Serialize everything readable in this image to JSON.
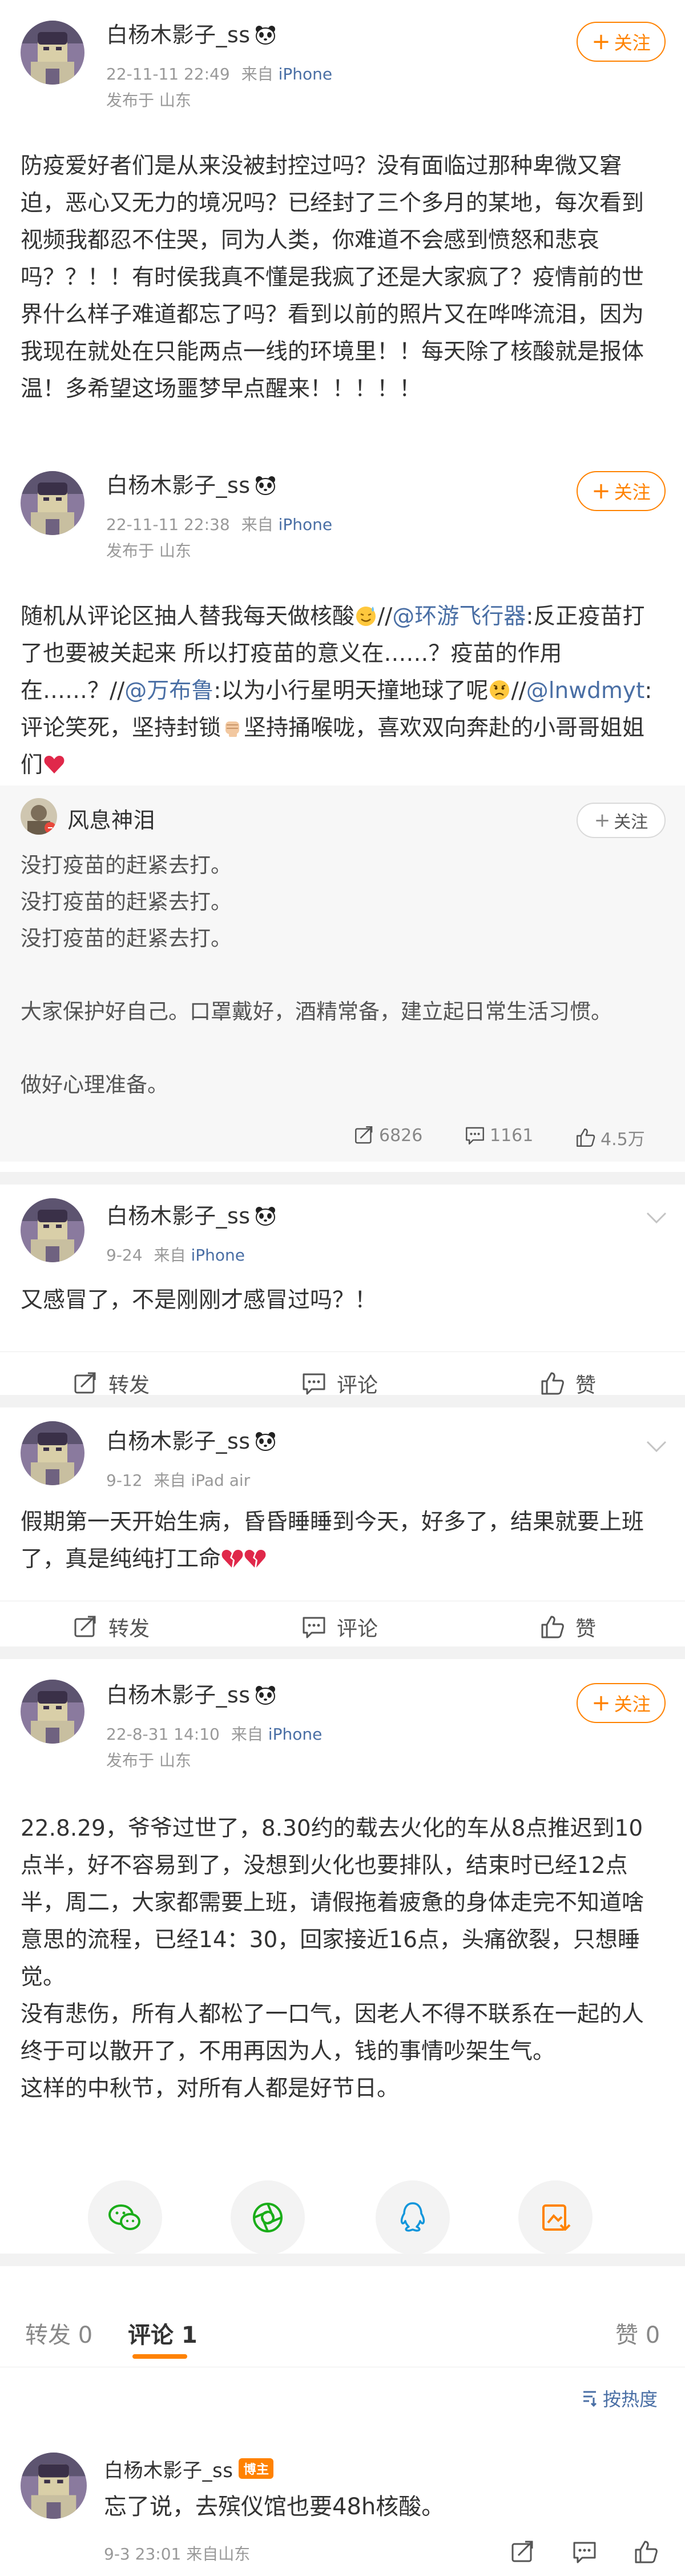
{
  "posts": [
    {
      "user": "白杨木影子_ss",
      "time": "22-11-11 22:49",
      "source_prefix": "来自",
      "device": "iPhone",
      "location": "发布于 山东",
      "follow_label": "关注",
      "text": "防疫爱好者们是从来没被封控过吗？没有面临过那种卑微又窘迫，恶心又无力的境况吗？已经封了三个多月的某地，每次看到视频我都忍不住哭，同为人类，你难道不会感到愤怒和悲哀吗？？！！有时侯我真不懂是我疯了还是大家疯了？疫情前的世界什么样子难道都忘了吗？看到以前的照片又在哗哗流泪，因为我现在就处在只能两点一线的环境里！！每天除了核酸就是报体温！多希望这场噩梦早点醒来！！！！！"
    },
    {
      "user": "白杨木影子_ss",
      "time": "22-11-11 22:38",
      "source_prefix": "来自",
      "device": "iPhone",
      "location": "发布于 山东",
      "follow_label": "关注",
      "text_parts": {
        "p1": "随机从评论区抽人替我每天做核酸",
        "p2": "//",
        "m1": "@环游飞行器",
        "p3": ":反正疫苗打了也要被关起来 所以打疫苗的意义在……？疫苗的作用在……？//",
        "m2": "@万布鲁",
        "p4": ":以为小行星明天撞地球了呢",
        "p5": "//",
        "m3": "@lnwdmyt",
        "p6": ":评论笑死，坚持封锁",
        "p7": "坚持捅喉咙，喜欢双向奔赴的小哥哥姐姐们"
      },
      "repost": {
        "user": "风息神泪",
        "follow_label": "关注",
        "text": "没打疫苗的赶紧去打。\n没打疫苗的赶紧去打。\n没打疫苗的赶紧去打。\n\n大家保护好自己。口罩戴好，酒精常备，建立起日常生活习惯。\n\n做好心理准备。",
        "reposts": "6826",
        "comments": "1161",
        "likes": "4.5万"
      }
    },
    {
      "user": "白杨木影子_ss",
      "time": "9-24",
      "source_prefix": "来自",
      "device": "iPhone",
      "text": "又感冒了，不是刚刚才感冒过吗？！"
    },
    {
      "user": "白杨木影子_ss",
      "time": "9-12",
      "source_prefix": "来自",
      "device": "iPad air",
      "text": "假期第一天开始生病，昏昏睡睡到今天，好多了，结果就要上班了，真是纯纯打工命"
    },
    {
      "user": "白杨木影子_ss",
      "time": "22-8-31 14:10",
      "source_prefix": "来自",
      "device": "iPhone",
      "location": "发布于 山东",
      "follow_label": "关注",
      "text": "22.8.29，爷爷过世了，8.30约的载去火化的车从8点推迟到10点半，好不容易到了，没想到火化也要排队，结束时已经12点半，周二，大家都需要上班，请假拖着疲惫的身体走完不知道啥意思的流程，已经14：30，回家接近16点，头痛欲裂，只想睡觉。\n没有悲伤，所有人都松了一口气，因老人不得不联系在一起的人终于可以散开了，不用再因为人，钱的事情吵架生气。\n这样的中秋节，对所有人都是好节日。"
    }
  ],
  "actions": {
    "repost": "转发",
    "comment": "评论",
    "like": "赞"
  },
  "tabs": {
    "repost": "转发 0",
    "comment": "评论 1",
    "like": "赞 0"
  },
  "sort_label": "按热度",
  "comment": {
    "user": "白杨木影子_ss",
    "badge": "博主",
    "text": "忘了说，去殡仪馆也要48h核酸。",
    "meta": "9-3 23:01 来自山东"
  },
  "colors": {
    "accent": "#ff8200",
    "link": "#4a6fa5",
    "heart": "#e0284a"
  }
}
